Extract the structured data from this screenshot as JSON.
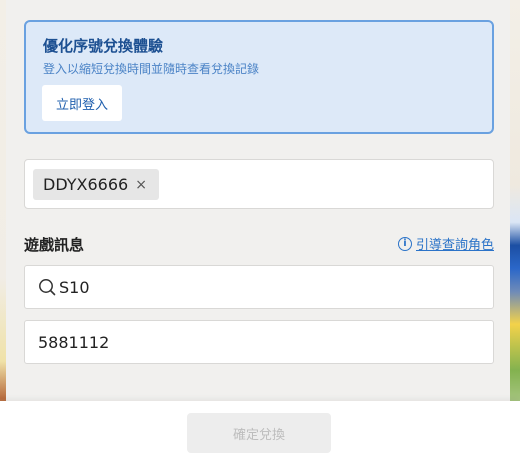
{
  "promo": {
    "title": "優化序號兌換體驗",
    "subtitle": "登入以縮短兌換時間並隨時查看兌換記錄",
    "login_label": "立即登入"
  },
  "code_input": {
    "tags": [
      {
        "text": "DDYX6666",
        "remove_icon": "×"
      }
    ]
  },
  "game_info": {
    "title": "遊戲訊息",
    "guide_link": "引導查詢角色",
    "server_value": "S10",
    "role_value": "5881112"
  },
  "footer": {
    "confirm_label": "確定兌換"
  },
  "colors": {
    "accent": "#2b73c8",
    "promo_bg": "#dde9f8",
    "promo_border": "#6aa1e0"
  }
}
